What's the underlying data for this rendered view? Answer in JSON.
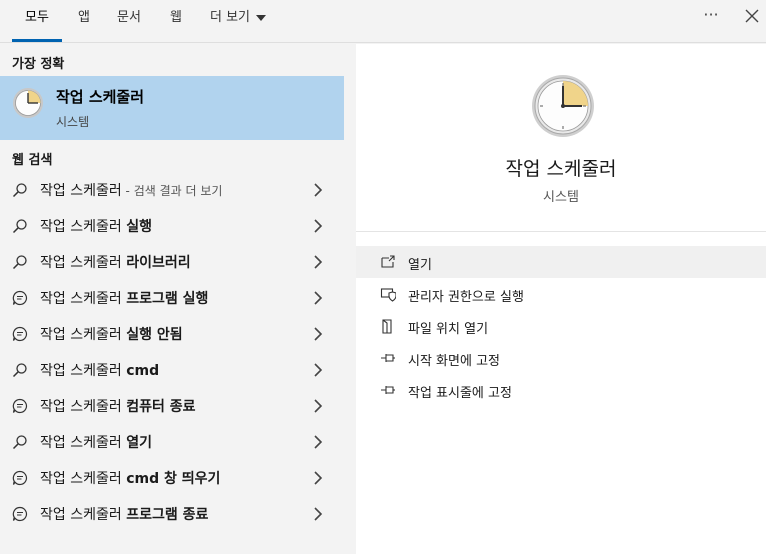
{
  "tabs": [
    {
      "label": "모두",
      "active": true
    },
    {
      "label": "앱"
    },
    {
      "label": "문서"
    },
    {
      "label": "웹"
    },
    {
      "label": "더 보기"
    }
  ],
  "header_buttons": {
    "more": "···",
    "close": "close-icon"
  },
  "best_match": {
    "section_title": "가장 정확",
    "app_name": "작업 스케줄러",
    "app_kind": "시스템",
    "icon": "clock-icon"
  },
  "web_search": {
    "section_title": "웹 검색",
    "items": [
      {
        "prefix": "작업 스케줄러",
        "bold": "",
        "sub": " - 검색 결과 더 보기",
        "icon": "search-icon"
      },
      {
        "prefix": "작업 스케줄러 ",
        "bold": "실행",
        "sub": "",
        "icon": "search-icon"
      },
      {
        "prefix": "작업 스케줄러 ",
        "bold": "라이브러리",
        "sub": "",
        "icon": "search-icon"
      },
      {
        "prefix": "작업 스케줄러 ",
        "bold": "프로그램 실행",
        "sub": "",
        "icon": "chat-icon"
      },
      {
        "prefix": "작업 스케줄러 ",
        "bold": "실행 안됨",
        "sub": "",
        "icon": "chat-icon"
      },
      {
        "prefix": "작업 스케줄러 ",
        "bold": "cmd",
        "sub": "",
        "icon": "search-icon"
      },
      {
        "prefix": "작업 스케줄러 ",
        "bold": "컴퓨터 종료",
        "sub": "",
        "icon": "chat-icon"
      },
      {
        "prefix": "작업 스케줄러 ",
        "bold": "열기",
        "sub": "",
        "icon": "search-icon"
      },
      {
        "prefix": "작업 스케줄러 ",
        "bold": "cmd 창 띄우기",
        "sub": "",
        "icon": "chat-icon"
      },
      {
        "prefix": "작업 스케줄러 ",
        "bold": "프로그램 종료",
        "sub": "",
        "icon": "chat-icon"
      }
    ]
  },
  "preview": {
    "app_name": "작업 스케줄러",
    "app_kind": "시스템",
    "actions": [
      {
        "label": "열기",
        "icon": "open-icon"
      },
      {
        "label": "관리자 권한으로 실행",
        "icon": "shield-icon"
      },
      {
        "label": "파일 위치 열기",
        "icon": "file-location-icon"
      },
      {
        "label": "시작 화면에 고정",
        "icon": "pin-icon"
      },
      {
        "label": "작업 표시줄에 고정",
        "icon": "pin-icon"
      }
    ]
  },
  "colors": {
    "accent": "#0063b1",
    "selection": "#b1d3ee"
  }
}
